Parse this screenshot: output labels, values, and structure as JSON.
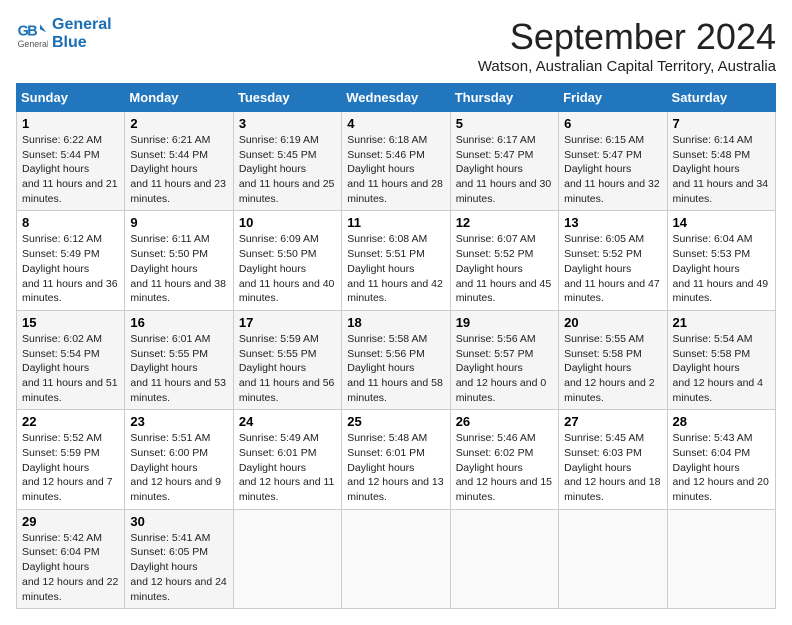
{
  "header": {
    "logo_line1": "General",
    "logo_line2": "Blue",
    "month": "September 2024",
    "location": "Watson, Australian Capital Territory, Australia"
  },
  "weekdays": [
    "Sunday",
    "Monday",
    "Tuesday",
    "Wednesday",
    "Thursday",
    "Friday",
    "Saturday"
  ],
  "weeks": [
    [
      {
        "day": "1",
        "sunrise": "6:22 AM",
        "sunset": "5:44 PM",
        "daylight": "11 hours and 21 minutes."
      },
      {
        "day": "2",
        "sunrise": "6:21 AM",
        "sunset": "5:44 PM",
        "daylight": "11 hours and 23 minutes."
      },
      {
        "day": "3",
        "sunrise": "6:19 AM",
        "sunset": "5:45 PM",
        "daylight": "11 hours and 25 minutes."
      },
      {
        "day": "4",
        "sunrise": "6:18 AM",
        "sunset": "5:46 PM",
        "daylight": "11 hours and 28 minutes."
      },
      {
        "day": "5",
        "sunrise": "6:17 AM",
        "sunset": "5:47 PM",
        "daylight": "11 hours and 30 minutes."
      },
      {
        "day": "6",
        "sunrise": "6:15 AM",
        "sunset": "5:47 PM",
        "daylight": "11 hours and 32 minutes."
      },
      {
        "day": "7",
        "sunrise": "6:14 AM",
        "sunset": "5:48 PM",
        "daylight": "11 hours and 34 minutes."
      }
    ],
    [
      {
        "day": "8",
        "sunrise": "6:12 AM",
        "sunset": "5:49 PM",
        "daylight": "11 hours and 36 minutes."
      },
      {
        "day": "9",
        "sunrise": "6:11 AM",
        "sunset": "5:50 PM",
        "daylight": "11 hours and 38 minutes."
      },
      {
        "day": "10",
        "sunrise": "6:09 AM",
        "sunset": "5:50 PM",
        "daylight": "11 hours and 40 minutes."
      },
      {
        "day": "11",
        "sunrise": "6:08 AM",
        "sunset": "5:51 PM",
        "daylight": "11 hours and 42 minutes."
      },
      {
        "day": "12",
        "sunrise": "6:07 AM",
        "sunset": "5:52 PM",
        "daylight": "11 hours and 45 minutes."
      },
      {
        "day": "13",
        "sunrise": "6:05 AM",
        "sunset": "5:52 PM",
        "daylight": "11 hours and 47 minutes."
      },
      {
        "day": "14",
        "sunrise": "6:04 AM",
        "sunset": "5:53 PM",
        "daylight": "11 hours and 49 minutes."
      }
    ],
    [
      {
        "day": "15",
        "sunrise": "6:02 AM",
        "sunset": "5:54 PM",
        "daylight": "11 hours and 51 minutes."
      },
      {
        "day": "16",
        "sunrise": "6:01 AM",
        "sunset": "5:55 PM",
        "daylight": "11 hours and 53 minutes."
      },
      {
        "day": "17",
        "sunrise": "5:59 AM",
        "sunset": "5:55 PM",
        "daylight": "11 hours and 56 minutes."
      },
      {
        "day": "18",
        "sunrise": "5:58 AM",
        "sunset": "5:56 PM",
        "daylight": "11 hours and 58 minutes."
      },
      {
        "day": "19",
        "sunrise": "5:56 AM",
        "sunset": "5:57 PM",
        "daylight": "12 hours and 0 minutes."
      },
      {
        "day": "20",
        "sunrise": "5:55 AM",
        "sunset": "5:58 PM",
        "daylight": "12 hours and 2 minutes."
      },
      {
        "day": "21",
        "sunrise": "5:54 AM",
        "sunset": "5:58 PM",
        "daylight": "12 hours and 4 minutes."
      }
    ],
    [
      {
        "day": "22",
        "sunrise": "5:52 AM",
        "sunset": "5:59 PM",
        "daylight": "12 hours and 7 minutes."
      },
      {
        "day": "23",
        "sunrise": "5:51 AM",
        "sunset": "6:00 PM",
        "daylight": "12 hours and 9 minutes."
      },
      {
        "day": "24",
        "sunrise": "5:49 AM",
        "sunset": "6:01 PM",
        "daylight": "12 hours and 11 minutes."
      },
      {
        "day": "25",
        "sunrise": "5:48 AM",
        "sunset": "6:01 PM",
        "daylight": "12 hours and 13 minutes."
      },
      {
        "day": "26",
        "sunrise": "5:46 AM",
        "sunset": "6:02 PM",
        "daylight": "12 hours and 15 minutes."
      },
      {
        "day": "27",
        "sunrise": "5:45 AM",
        "sunset": "6:03 PM",
        "daylight": "12 hours and 18 minutes."
      },
      {
        "day": "28",
        "sunrise": "5:43 AM",
        "sunset": "6:04 PM",
        "daylight": "12 hours and 20 minutes."
      }
    ],
    [
      {
        "day": "29",
        "sunrise": "5:42 AM",
        "sunset": "6:04 PM",
        "daylight": "12 hours and 22 minutes."
      },
      {
        "day": "30",
        "sunrise": "5:41 AM",
        "sunset": "6:05 PM",
        "daylight": "12 hours and 24 minutes."
      },
      null,
      null,
      null,
      null,
      null
    ]
  ]
}
